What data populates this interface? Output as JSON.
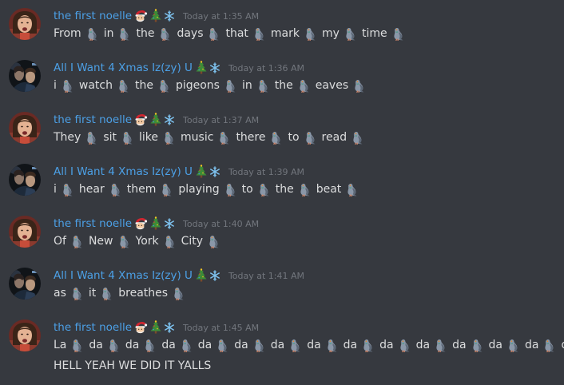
{
  "messages": [
    {
      "author": "the first noelle",
      "decorations": [
        "santa-emoji",
        "christmas-tree-emoji",
        "snowflake-emoji"
      ],
      "time": "Today at 1:35 AM",
      "avatar": "noelle",
      "lines": [
        [
          "From",
          "in",
          "the",
          "days",
          "that",
          "mark",
          "my",
          "time"
        ]
      ]
    },
    {
      "author": "All I Want 4 Xmas Iz(zy) U",
      "decorations": [
        "christmas-tree-emoji",
        "snowflake-emoji"
      ],
      "time": "Today at 1:36 AM",
      "avatar": "izzy",
      "lines": [
        [
          "i",
          "watch",
          "the",
          "pigeons",
          "in",
          "the",
          "eaves"
        ]
      ]
    },
    {
      "author": "the first noelle",
      "decorations": [
        "santa-emoji",
        "christmas-tree-emoji",
        "snowflake-emoji"
      ],
      "time": "Today at 1:37 AM",
      "avatar": "noelle",
      "lines": [
        [
          "They",
          "sit",
          "like",
          "music",
          "there",
          "to",
          "read"
        ]
      ]
    },
    {
      "author": "All I Want 4 Xmas Iz(zy) U",
      "decorations": [
        "christmas-tree-emoji",
        "snowflake-emoji"
      ],
      "time": "Today at 1:39 AM",
      "avatar": "izzy",
      "lines": [
        [
          "i",
          "hear",
          "them",
          "playing",
          "to",
          "the",
          "beat"
        ]
      ]
    },
    {
      "author": "the first noelle",
      "decorations": [
        "santa-emoji",
        "christmas-tree-emoji",
        "snowflake-emoji"
      ],
      "time": "Today at 1:40 AM",
      "avatar": "noelle",
      "lines": [
        [
          "Of",
          "New",
          "York",
          "City"
        ]
      ]
    },
    {
      "author": "All I Want 4 Xmas Iz(zy) U",
      "decorations": [
        "christmas-tree-emoji",
        "snowflake-emoji"
      ],
      "time": "Today at 1:41 AM",
      "avatar": "izzy",
      "lines": [
        [
          "as",
          "it",
          "breathes"
        ]
      ]
    },
    {
      "author": "the first noelle",
      "decorations": [
        "santa-emoji",
        "christmas-tree-emoji",
        "snowflake-emoji"
      ],
      "time": "Today at 1:45 AM",
      "avatar": "noelle",
      "lines": [
        [
          "La",
          "da",
          "da",
          "da",
          "da",
          "da",
          "da",
          "da",
          "da",
          "da",
          "da",
          "da",
          "da",
          "da",
          "da"
        ],
        "HELL YEAH WE DID IT YALLS"
      ]
    }
  ],
  "pigeon_emoji": "pigeon-emoji",
  "colors": {
    "background": "#36393f",
    "username": "#4ca0e6",
    "timestamp": "#72767d",
    "text": "#dcddde"
  }
}
